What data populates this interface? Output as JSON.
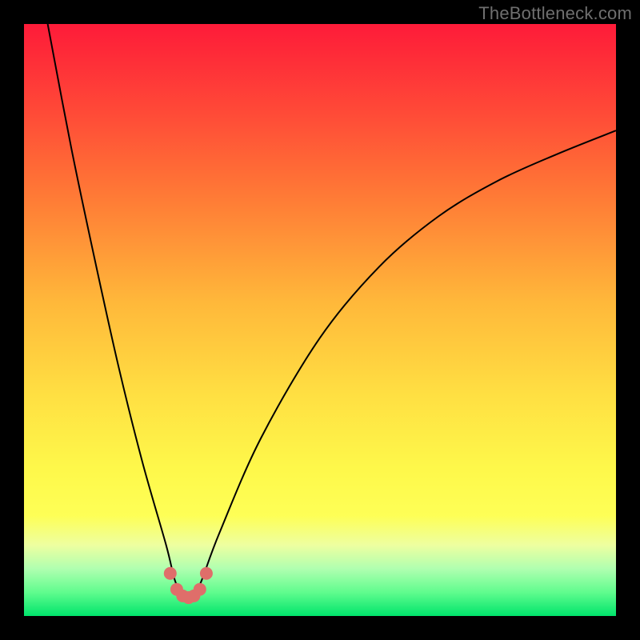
{
  "watermark": "TheBottleneck.com",
  "chart_data": {
    "type": "line",
    "title": "",
    "xlabel": "",
    "ylabel": "",
    "xlim": [
      0,
      100
    ],
    "ylim": [
      0,
      100
    ],
    "grid": false,
    "series": [
      {
        "name": "bottleneck-curve",
        "x": [
          4,
          8,
          12,
          16,
          20,
          24,
          25.5,
          27,
          28.5,
          30,
          33,
          40,
          50,
          60,
          70,
          80,
          90,
          100
        ],
        "values": [
          100,
          79,
          60,
          42,
          26,
          12,
          6,
          3,
          3,
          6,
          14,
          30,
          47,
          59,
          67.5,
          73.5,
          78,
          82
        ]
      }
    ],
    "markers": {
      "name": "bottom-dots",
      "x": [
        24.7,
        25.8,
        26.8,
        27.8,
        28.7,
        29.7,
        30.8
      ],
      "values": [
        7.2,
        4.5,
        3.4,
        3.1,
        3.4,
        4.5,
        7.2
      ],
      "color": "#df6e6a",
      "radius_px": 8
    },
    "background_gradient": [
      "#fe1b39",
      "#ff7d36",
      "#ffde42",
      "#eeffa0",
      "#00e46b"
    ]
  }
}
